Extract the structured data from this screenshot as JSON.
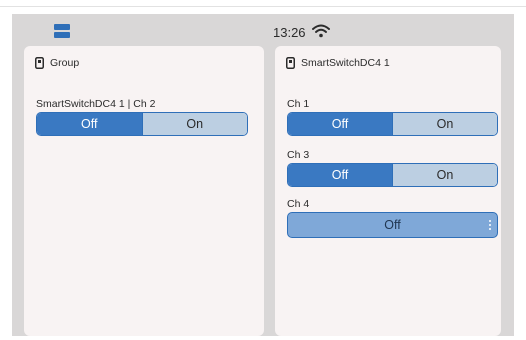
{
  "status_bar": {
    "time": "13:26"
  },
  "group_card": {
    "title": "Group",
    "channel_label": "SmartSwitchDC4 1 | Ch 2",
    "toggle": {
      "off_label": "Off",
      "on_label": "On",
      "selected": "Off"
    }
  },
  "device_card": {
    "title": "SmartSwitchDC4 1",
    "ch1": {
      "label": "Ch 1",
      "off_label": "Off",
      "on_label": "On",
      "selected": "Off"
    },
    "ch3": {
      "label": "Ch 3",
      "off_label": "Off",
      "on_label": "On",
      "selected": "Off"
    },
    "ch4": {
      "label": "Ch 4",
      "value_label": "Off"
    }
  },
  "colors": {
    "accent": "#2f6fb8",
    "selected_fill": "#3a79c2",
    "unselected_fill": "#bccfe2",
    "card_bg": "#f8f3f3",
    "screen_bg": "#d9d7d7"
  },
  "icons": {
    "layout": "layout-icon",
    "wifi": "wifi-icon",
    "device": "device-icon",
    "menu": "kebab-menu-icon"
  }
}
